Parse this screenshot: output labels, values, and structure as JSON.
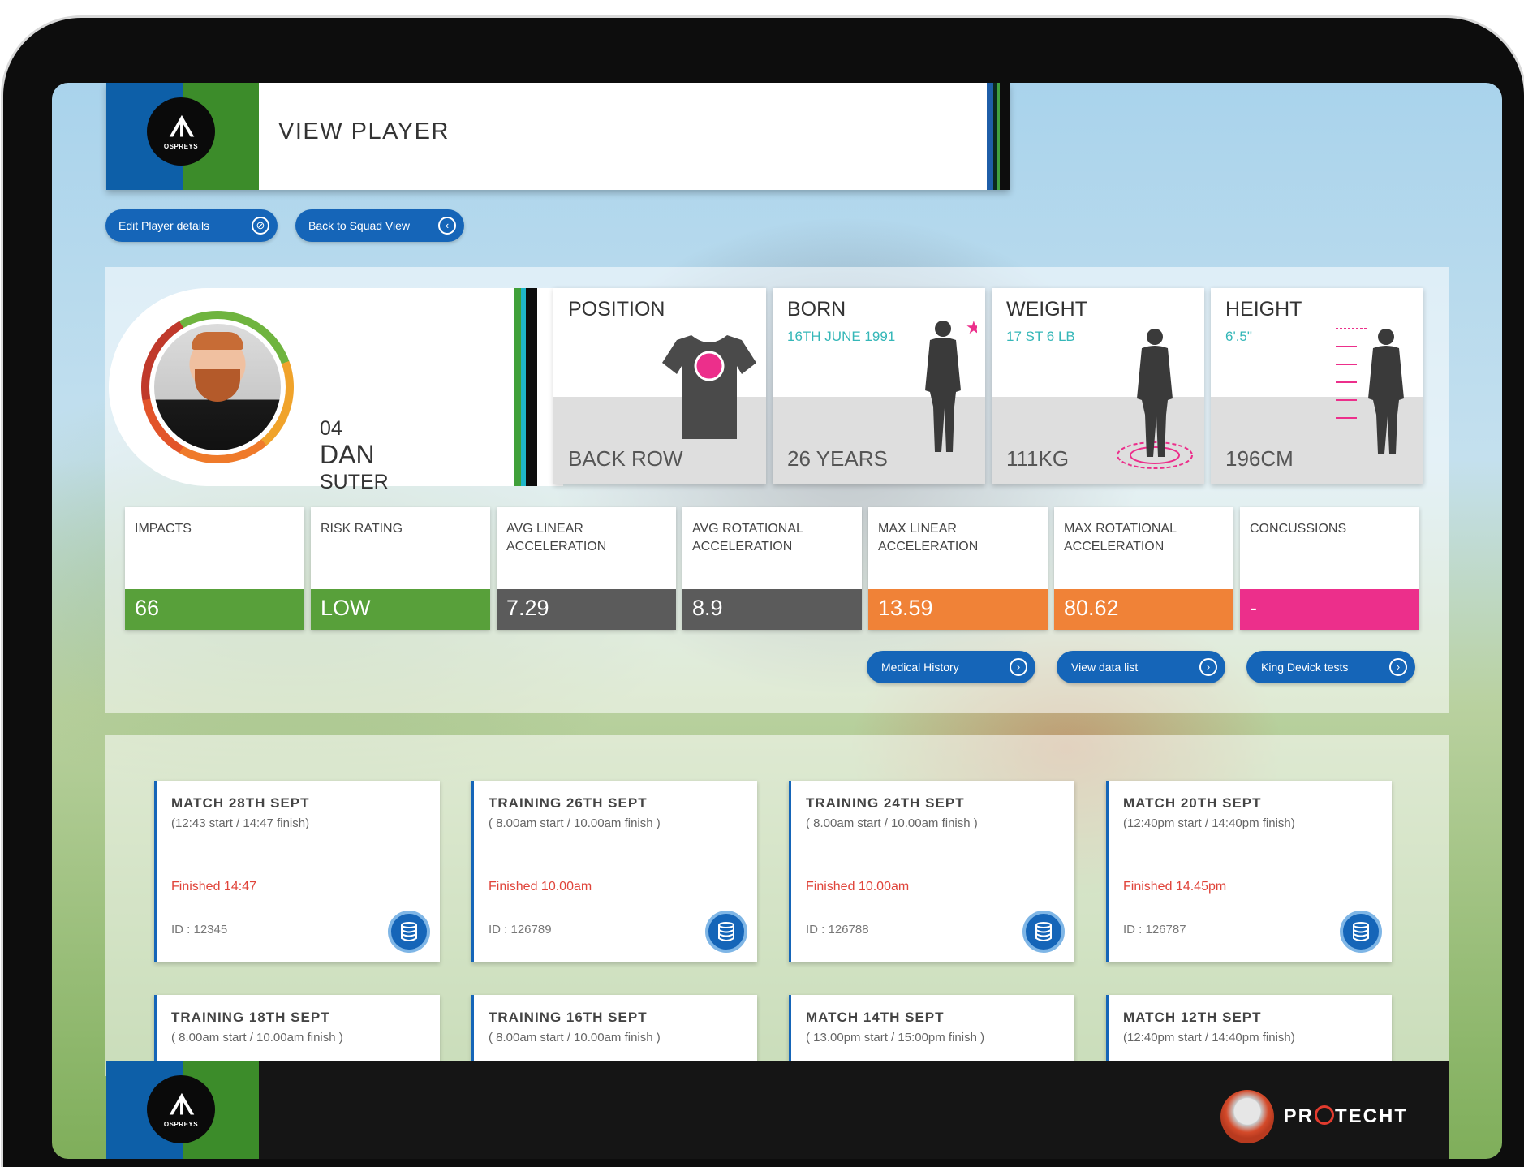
{
  "header": {
    "title": "VIEW PLAYER",
    "logo_mark": "ᗑ",
    "logo_text": "OSPREYS"
  },
  "actions": {
    "edit": "Edit Player details",
    "back": "Back to Squad View",
    "medical": "Medical History",
    "datalist": "View data list",
    "kingdevick": "King Devick tests"
  },
  "player": {
    "number": "04",
    "first_name": "DAN",
    "last_name": "SUTER"
  },
  "stats": {
    "position": {
      "label": "POSITION",
      "value": "BACK ROW"
    },
    "born": {
      "label": "BORN",
      "date": "16TH JUNE 1991",
      "value": "26 YEARS"
    },
    "weight": {
      "label": "WEIGHT",
      "imperial": "17 ST 6 LB",
      "value": "111KG"
    },
    "height": {
      "label": "HEIGHT",
      "imperial": "6'.5\"",
      "value": "196CM"
    }
  },
  "metrics": [
    {
      "label": "IMPACTS",
      "value": "66",
      "color": "#58a03a"
    },
    {
      "label": "RISK RATING",
      "value": "LOW",
      "color": "#58a03a"
    },
    {
      "label": "AVG LINEAR ACCELERATION",
      "value": "7.29",
      "color": "#5b5b5b"
    },
    {
      "label": "AVG ROTATIONAL ACCELERATION",
      "value": "8.9",
      "color": "#5b5b5b"
    },
    {
      "label": "MAX LINEAR ACCELERATION",
      "value": "13.59",
      "color": "#f08237"
    },
    {
      "label": "MAX ROTATIONAL ACCELERATION",
      "value": "80.62",
      "color": "#f08237"
    },
    {
      "label": "CONCUSSIONS",
      "value": "-",
      "color": "#ec2f8b"
    }
  ],
  "sessions": [
    {
      "title": "MATCH 28TH SEPT",
      "time": "(12:43 start / 14:47 finish)",
      "status": "Finished 14:47",
      "id": "ID : 12345"
    },
    {
      "title": "TRAINING 26TH SEPT",
      "time": "( 8.00am start / 10.00am finish )",
      "status": "Finished 10.00am",
      "id": "ID : 126789"
    },
    {
      "title": "TRAINING 24TH SEPT",
      "time": "( 8.00am start / 10.00am finish )",
      "status": "Finished 10.00am",
      "id": "ID : 126788"
    },
    {
      "title": "MATCH 20TH SEPT",
      "time": "(12:40pm start / 14:40pm finish)",
      "status": "Finished 14.45pm",
      "id": "ID : 126787"
    },
    {
      "title": "TRAINING 18TH SEPT",
      "time": "( 8.00am start / 10.00am finish )"
    },
    {
      "title": "TRAINING 16TH SEPT",
      "time": "( 8.00am start / 10.00am finish )"
    },
    {
      "title": "MATCH 14TH SEPT",
      "time": "( 13.00pm start / 15:00pm finish )"
    },
    {
      "title": "MATCH 12TH SEPT",
      "time": "(12:40pm start / 14:40pm finish)"
    }
  ],
  "footer": {
    "brand": "PROTECHT",
    "brand_pre": "PR",
    "brand_post": "TECHT"
  },
  "icons": {
    "edit": "compass-icon",
    "back": "chevron-left-icon",
    "arrow": "chevron-right-icon",
    "database": "database-icon"
  }
}
